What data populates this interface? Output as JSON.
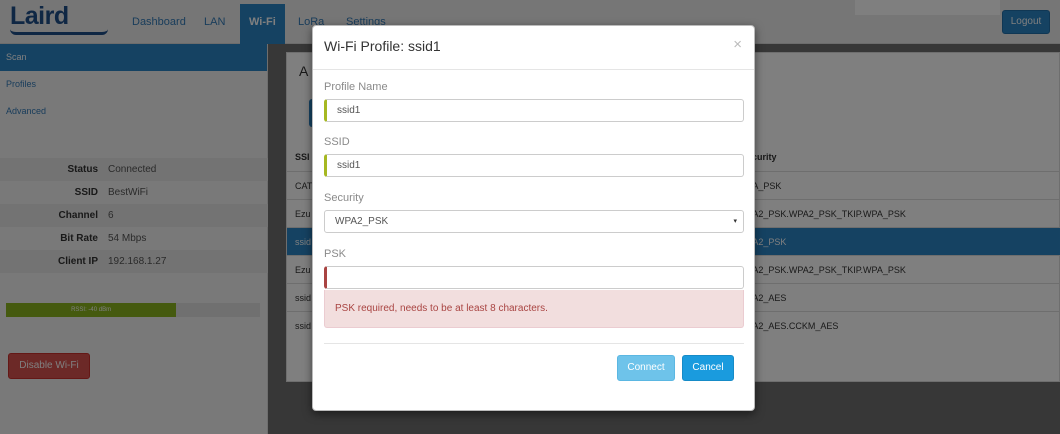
{
  "brand": {
    "logo_text": "Laird"
  },
  "nav": {
    "items": [
      {
        "label": "Dashboard"
      },
      {
        "label": "LAN"
      },
      {
        "label": "Wi-Fi"
      },
      {
        "label": "LoRa"
      },
      {
        "label": "Settings"
      }
    ],
    "logout_label": "Logout"
  },
  "sidebar": {
    "links": [
      {
        "label": "Scan"
      },
      {
        "label": "Profiles"
      },
      {
        "label": "Advanced"
      }
    ],
    "status": [
      {
        "label": "Status",
        "value": "Connected"
      },
      {
        "label": "SSID",
        "value": "BestWiFi"
      },
      {
        "label": "Channel",
        "value": "6"
      },
      {
        "label": "Bit Rate",
        "value": "54 Mbps"
      },
      {
        "label": "Client IP",
        "value": "192.168.1.27"
      }
    ],
    "signal_label": "RSSI: -40 dBm",
    "signal_fraction": 0.67,
    "disable_button": "Disable Wi-Fi"
  },
  "main": {
    "heading": "A",
    "table_header_ssid": "SSI",
    "table_header_security": "ecurity",
    "rows": [
      {
        "ssid": "CAT",
        "security": "PA_PSK"
      },
      {
        "ssid": "Ezu",
        "security": "PA2_PSK.WPA2_PSK_TKIP.WPA_PSK"
      },
      {
        "ssid": "ssid",
        "security": "PA2_PSK"
      },
      {
        "ssid": "Ezu",
        "security": "PA2_PSK.WPA2_PSK_TKIP.WPA_PSK"
      },
      {
        "ssid": "ssid",
        "security": "PA2_AES"
      },
      {
        "ssid": "ssid",
        "security": "PA2_AES.CCKM_AES"
      }
    ],
    "selected_row": 2
  },
  "modal": {
    "title": "Wi-Fi Profile: ssid1",
    "close_glyph": "×",
    "profile_name_label": "Profile Name",
    "profile_name_value": "ssid1",
    "ssid_label": "SSID",
    "ssid_value": "ssid1",
    "security_label": "Security",
    "security_value": "WPA2_PSK",
    "caret_glyph": "▾",
    "psk_label": "PSK",
    "psk_value": "",
    "error_text": "PSK required, needs to be at least 8 characters.",
    "connect_label": "Connect",
    "cancel_label": "Cancel"
  }
}
